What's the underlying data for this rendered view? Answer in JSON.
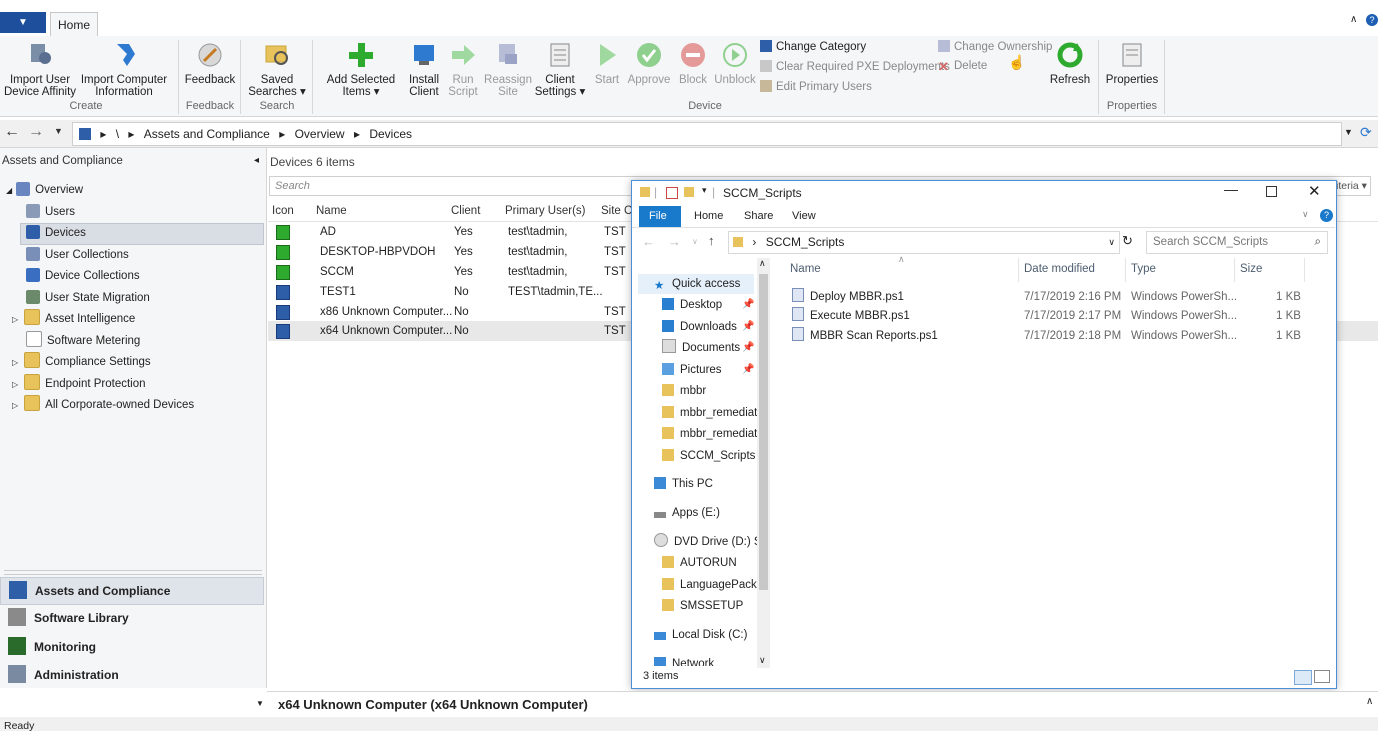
{
  "app": {
    "menu_label": "▼",
    "home_tab": "Home"
  },
  "ribbon": {
    "create": {
      "import_affinity": "Import User Device Affinity",
      "import_computer": "Import Computer Information",
      "group": "Create"
    },
    "feedback": {
      "label": "Feedback",
      "group": "Feedback"
    },
    "search": {
      "saved_searches": "Saved Searches",
      "group": "Search"
    },
    "device": {
      "add_selected": "Add Selected Items",
      "install_client": "Install Client",
      "run_script": "Run Script",
      "reassign_site": "Reassign Site",
      "client_settings": "Client Settings",
      "start": "Start",
      "approve": "Approve",
      "block": "Block",
      "unblock": "Unblock",
      "change_category": "Change Category",
      "clear_pxe": "Clear Required PXE Deployments",
      "edit_primary": "Edit Primary Users",
      "change_ownership": "Change Ownership",
      "delete": "Delete",
      "refresh": "Refresh",
      "group": "Device"
    },
    "properties": {
      "label": "Properties",
      "group": "Properties"
    }
  },
  "breadcrumb": {
    "sep_root": "\\",
    "item1": "Assets and Compliance",
    "item2": "Overview",
    "item3": "Devices"
  },
  "leftpane": {
    "header": "Assets and Compliance",
    "tree": [
      "Overview",
      "Users",
      "Devices",
      "User Collections",
      "Device Collections",
      "User State Migration",
      "Asset Intelligence",
      "Software Metering",
      "Compliance Settings",
      "Endpoint Protection",
      "All Corporate-owned Devices"
    ],
    "wunderbar": [
      "Assets and Compliance",
      "Software Library",
      "Monitoring",
      "Administration"
    ]
  },
  "devices": {
    "header": "Devices 6 items",
    "search_placeholder": "Search",
    "criteria": "iteria",
    "columns": [
      "Icon",
      "Name",
      "Client",
      "Primary User(s)",
      "Site Co"
    ],
    "rows": [
      {
        "name": "AD",
        "client": "Yes",
        "user": "test\\tadmin,",
        "site": "TST"
      },
      {
        "name": "DESKTOP-HBPVDOH",
        "client": "Yes",
        "user": "test\\tadmin,",
        "site": "TST"
      },
      {
        "name": "SCCM",
        "client": "Yes",
        "user": "test\\tadmin,",
        "site": "TST"
      },
      {
        "name": "TEST1",
        "client": "No",
        "user": "TEST\\tadmin,TE...",
        "site": ""
      },
      {
        "name": "x86 Unknown Computer...",
        "client": "No",
        "user": "",
        "site": "TST"
      },
      {
        "name": "x64 Unknown Computer...",
        "client": "No",
        "user": "",
        "site": "TST"
      }
    ]
  },
  "explorer": {
    "title": "SCCM_Scripts",
    "tabs": [
      "File",
      "Home",
      "Share",
      "View"
    ],
    "address": "SCCM_Scripts",
    "search_placeholder": "Search SCCM_Scripts",
    "nav": [
      "Quick access",
      "Desktop",
      "Downloads",
      "Documents",
      "Pictures",
      "mbbr",
      "mbbr_remediatio",
      "mbbr_remediatio",
      "SCCM_Scripts",
      "This PC",
      "Apps (E:)",
      "DVD Drive (D:) SC",
      "AUTORUN",
      "LanguagePack",
      "SMSSETUP",
      "Local Disk (C:)",
      "Network"
    ],
    "columns": [
      "Name",
      "Date modified",
      "Type",
      "Size"
    ],
    "files": [
      {
        "name": "Deploy MBBR.ps1",
        "date": "7/17/2019 2:16 PM",
        "type": "Windows PowerSh...",
        "size": "1 KB"
      },
      {
        "name": "Execute MBBR.ps1",
        "date": "7/17/2019 2:17 PM",
        "type": "Windows PowerSh...",
        "size": "1 KB"
      },
      {
        "name": "MBBR Scan Reports.ps1",
        "date": "7/17/2019 2:18 PM",
        "type": "Windows PowerSh...",
        "size": "1 KB"
      }
    ],
    "status": "3 items"
  },
  "detail": {
    "title": "x64 Unknown Computer (x64 Unknown Computer)"
  },
  "status": {
    "text": "Ready"
  }
}
